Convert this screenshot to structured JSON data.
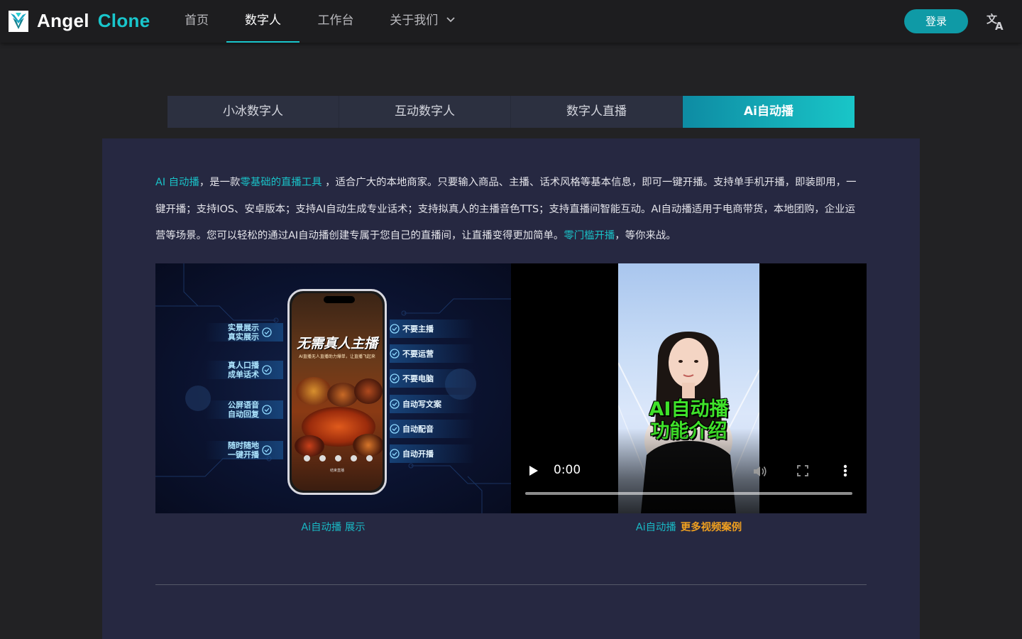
{
  "brand": {
    "name_part1": "Angel",
    "name_part2": "Clone",
    "accent_color": "#19c6cc"
  },
  "nav": {
    "items": [
      {
        "label": "首页",
        "active": false
      },
      {
        "label": "数字人",
        "active": true
      },
      {
        "label": "工作台",
        "active": false
      },
      {
        "label": "关于我们",
        "active": false,
        "has_dropdown": true
      }
    ],
    "login_label": "登录",
    "language_icon": "translate-icon"
  },
  "tabs": [
    {
      "label": "小冰数字人",
      "active": false
    },
    {
      "label": "互动数字人",
      "active": false
    },
    {
      "label": "数字人直播",
      "active": false
    },
    {
      "label": "Ai自动播",
      "active": true
    }
  ],
  "intro": {
    "seg1_highlight": "AI 自动播",
    "seg2": "，是一款",
    "seg3_highlight": "零基础的直播工具",
    "seg4": " ，适合广大的本地商家。只要输入商品、主播、话术风格等基本信息，即可一键开播。支持单手机开播，即装即用，一键开播；支持IOS、安卓版本；支持AI自动生成专业话术；支持拟真人的主播音色TTS；支持直播间智能互动。AI自动播适用于电商带货，本地团购，企业运营等场景。您可以轻松的通过AI自动播创建专属于您自己的直播间，让直播变得更加简单。",
    "seg5_highlight": "零门槛开播",
    "seg6": "，等你来战。"
  },
  "promo_image": {
    "left_features": [
      "实景展示\n真实展示",
      "真人口播\n成单话术",
      "公屏语音\n自动回复",
      "随时随地\n一键开播"
    ],
    "right_features": [
      "不要主播",
      "不要运营",
      "不要电脑",
      "自动写文案",
      "自动配音",
      "自动开播"
    ],
    "phone_title": "无需真人主播",
    "phone_subtitle": "AI直播无人直播助力爆单，让直播飞起来",
    "phone_bottom": "结束直播"
  },
  "video": {
    "overlay_title_line1": "AI自动播",
    "overlay_title_line2": "功能介绍",
    "time": "0:00",
    "progress": 0
  },
  "captions": {
    "left": "Ai自动播 展示",
    "right_prefix": "Ai自动播",
    "right_link": "更多视频案例"
  }
}
